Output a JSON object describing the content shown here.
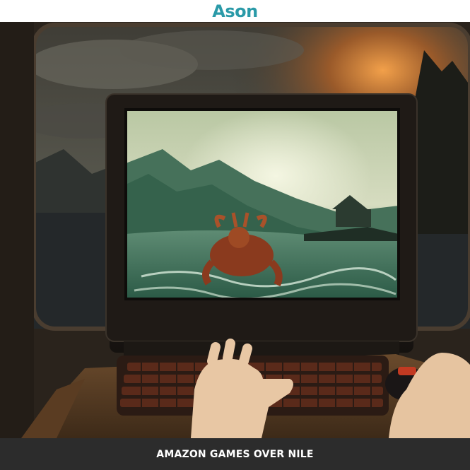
{
  "header": {
    "logo_text": "Ason"
  },
  "image": {
    "caption": "AMAZON GAMES OVER NILE"
  },
  "colors": {
    "logo_accent": "#2a9aa8",
    "logo_dark": "#4a4a4a",
    "caption_bar": "#2c2c2c",
    "caption_text": "#ffffff"
  }
}
